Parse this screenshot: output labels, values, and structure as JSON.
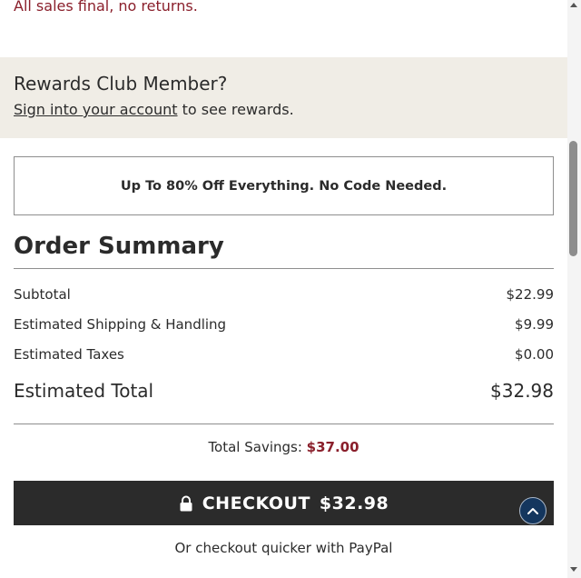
{
  "notice": {
    "final_sale_text": "All sales final, no returns."
  },
  "rewards": {
    "title": "Rewards Club Member?",
    "sign_in_link": "Sign into your account",
    "suffix_text": " to see rewards."
  },
  "promo": {
    "banner_text": "Up To 80% Off Everything. No Code Needed."
  },
  "order_summary": {
    "title": "Order Summary",
    "rows": [
      {
        "label": "Subtotal",
        "value": "$22.99"
      },
      {
        "label": "Estimated Shipping & Handling",
        "value": "$9.99"
      },
      {
        "label": "Estimated Taxes",
        "value": "$0.00"
      }
    ],
    "total": {
      "label": "Estimated Total",
      "value": "$32.98"
    },
    "savings": {
      "label": "Total Savings: ",
      "value": "$37.00"
    }
  },
  "checkout": {
    "label": "CHECKOUT",
    "amount": "$32.98",
    "icon": "lock-icon",
    "paypal_text": "Or checkout quicker with PayPal"
  },
  "colors": {
    "accent_red": "#8a1f2b",
    "rewards_bg": "#f0ede6",
    "checkout_bg": "#2b2b2b",
    "back_to_top_bg": "#14365e"
  },
  "icons": {
    "back_to_top": "chevron-up-icon"
  }
}
